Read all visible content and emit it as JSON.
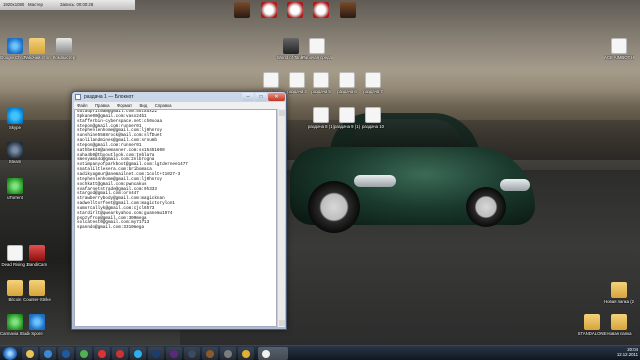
{
  "toolbar": {
    "items": [
      "1920x1080",
      "Мастер",
      "Запись: 00:00:28"
    ]
  },
  "desktop_icons": [
    {
      "label": "Google Chrome"
    },
    {
      "label": "Рабочий стол"
    },
    {
      "label": "Компьютер"
    },
    {
      "label": "Skype"
    },
    {
      "label": "Steam"
    },
    {
      "label": "uTorrent"
    },
    {
      "label": "Dead Rising 2"
    },
    {
      "label": "BandiCam"
    },
    {
      "label": "Bitcoin"
    },
    {
      "label": "Counter-Strike"
    },
    {
      "label": "Carmavia Studio 8"
    },
    {
      "label": "Spore"
    },
    {
      "label": "Новая папка (2)"
    },
    {
      "label": "Новая папка"
    },
    {
      "label": "ACE AIMBOT.HPG"
    },
    {
      "label": "World of Tanks"
    },
    {
      "label": "Рабочая среда"
    },
    {
      "label": "раздача 3"
    },
    {
      "label": "раздача 4"
    },
    {
      "label": "раздача 5"
    },
    {
      "label": "раздача 6"
    },
    {
      "label": "раздача 7"
    },
    {
      "label": "раздача 8 (1)"
    },
    {
      "label": "раздача 9 (1)"
    },
    {
      "label": "раздача 10"
    },
    {
      "label": "STANDALONE"
    }
  ],
  "notepad": {
    "title": "раздача 1 — Блокнот",
    "menu": [
      "Файл",
      "Правка",
      "Формат",
      "Вид",
      "Справка"
    ],
    "lines": [
      "5utaupritmam@gmail.com:5utaux22",
      "Spkane00@gmail.com:vasx24b1",
      "stafferbin-cyberspace.net:ch0ooaa",
      "stepon@gmail.com:runner01",
      "stephenlenhome@gmail.com:lj0hnroy",
      "sunshine5588rock@mail.com:slfDuet",
      "saolilandmines@gmail.com:srnumb",
      "stepon@gmail.com:runner01",
      "sathbek38@anemanner.com:ss15451600",
      "suha4b0@tbxoutlook.com:tebla7a",
      "smesyama4d@gmail.com:2nlbrogna",
      "sotimpanyofparkboot@gmail.com:lgtdernee1477",
      "snataliltlesera.com:bribomaca",
      "sadikyagmur@anemailnet.com:1colt+t1027-3",
      "stephenlenhome@gmail.com:lj0hnroy",
      "sochkatt@gmail.com:pwncakus",
      "svafarnetstrade@gmail.com:9h333",
      "stargod@gmail.com:orn447",
      "strawberrybody@gmail.com:magicknan",
      "sadwelltorfeet@gmail.com:magictorylon1",
      "sumorcallyk@gmail.com:cjcl6573",
      "stardirlt@qwearkyahoo.com:guanemu1974",
      "pspzyfrop@gmail.com:300mega",
      "solcatest0@gmail.com:my71713",
      "spanndo@gmail.com:3310mega"
    ]
  },
  "taskbar": {
    "clock_time": "20:04",
    "clock_date": "12.12.2011"
  },
  "colors": {
    "accent": "#2a6fc0",
    "close_button": "#c2321f",
    "car": "#1b3b2e"
  }
}
